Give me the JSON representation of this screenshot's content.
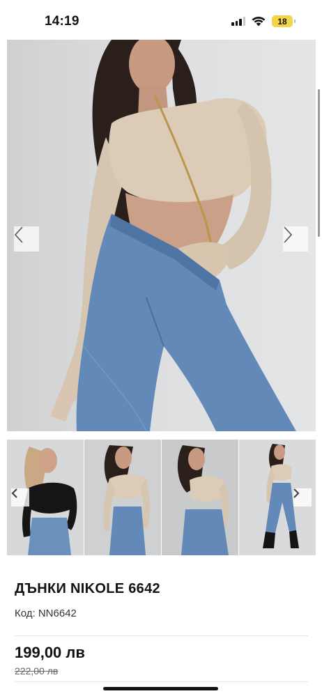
{
  "status_bar": {
    "time": "14:19",
    "battery_level": "18",
    "icons": [
      "cellular-signal-icon",
      "wifi-icon",
      "battery-icon"
    ]
  },
  "gallery": {
    "main_image": "model-wearing-blue-jeans-and-beige-crop-top",
    "thumbnails": [
      "model-black-top-blue-jeans",
      "model-beige-top-blue-jeans",
      "model-beige-top-blue-jeans-side",
      "model-full-length-blue-jeans"
    ],
    "prev_icon": "chevron-left-icon",
    "next_icon": "chevron-right-icon"
  },
  "product": {
    "title": "ДЪНКИ NIKOLE 6642",
    "code": "Код: NN6642",
    "price": "199,00 лв",
    "old_price": "222,00 лв"
  },
  "colors": {
    "denim": "#5f88b8",
    "beige": "#d8c8b4",
    "background": "#dcdddf",
    "battery": "#f2d64a"
  }
}
